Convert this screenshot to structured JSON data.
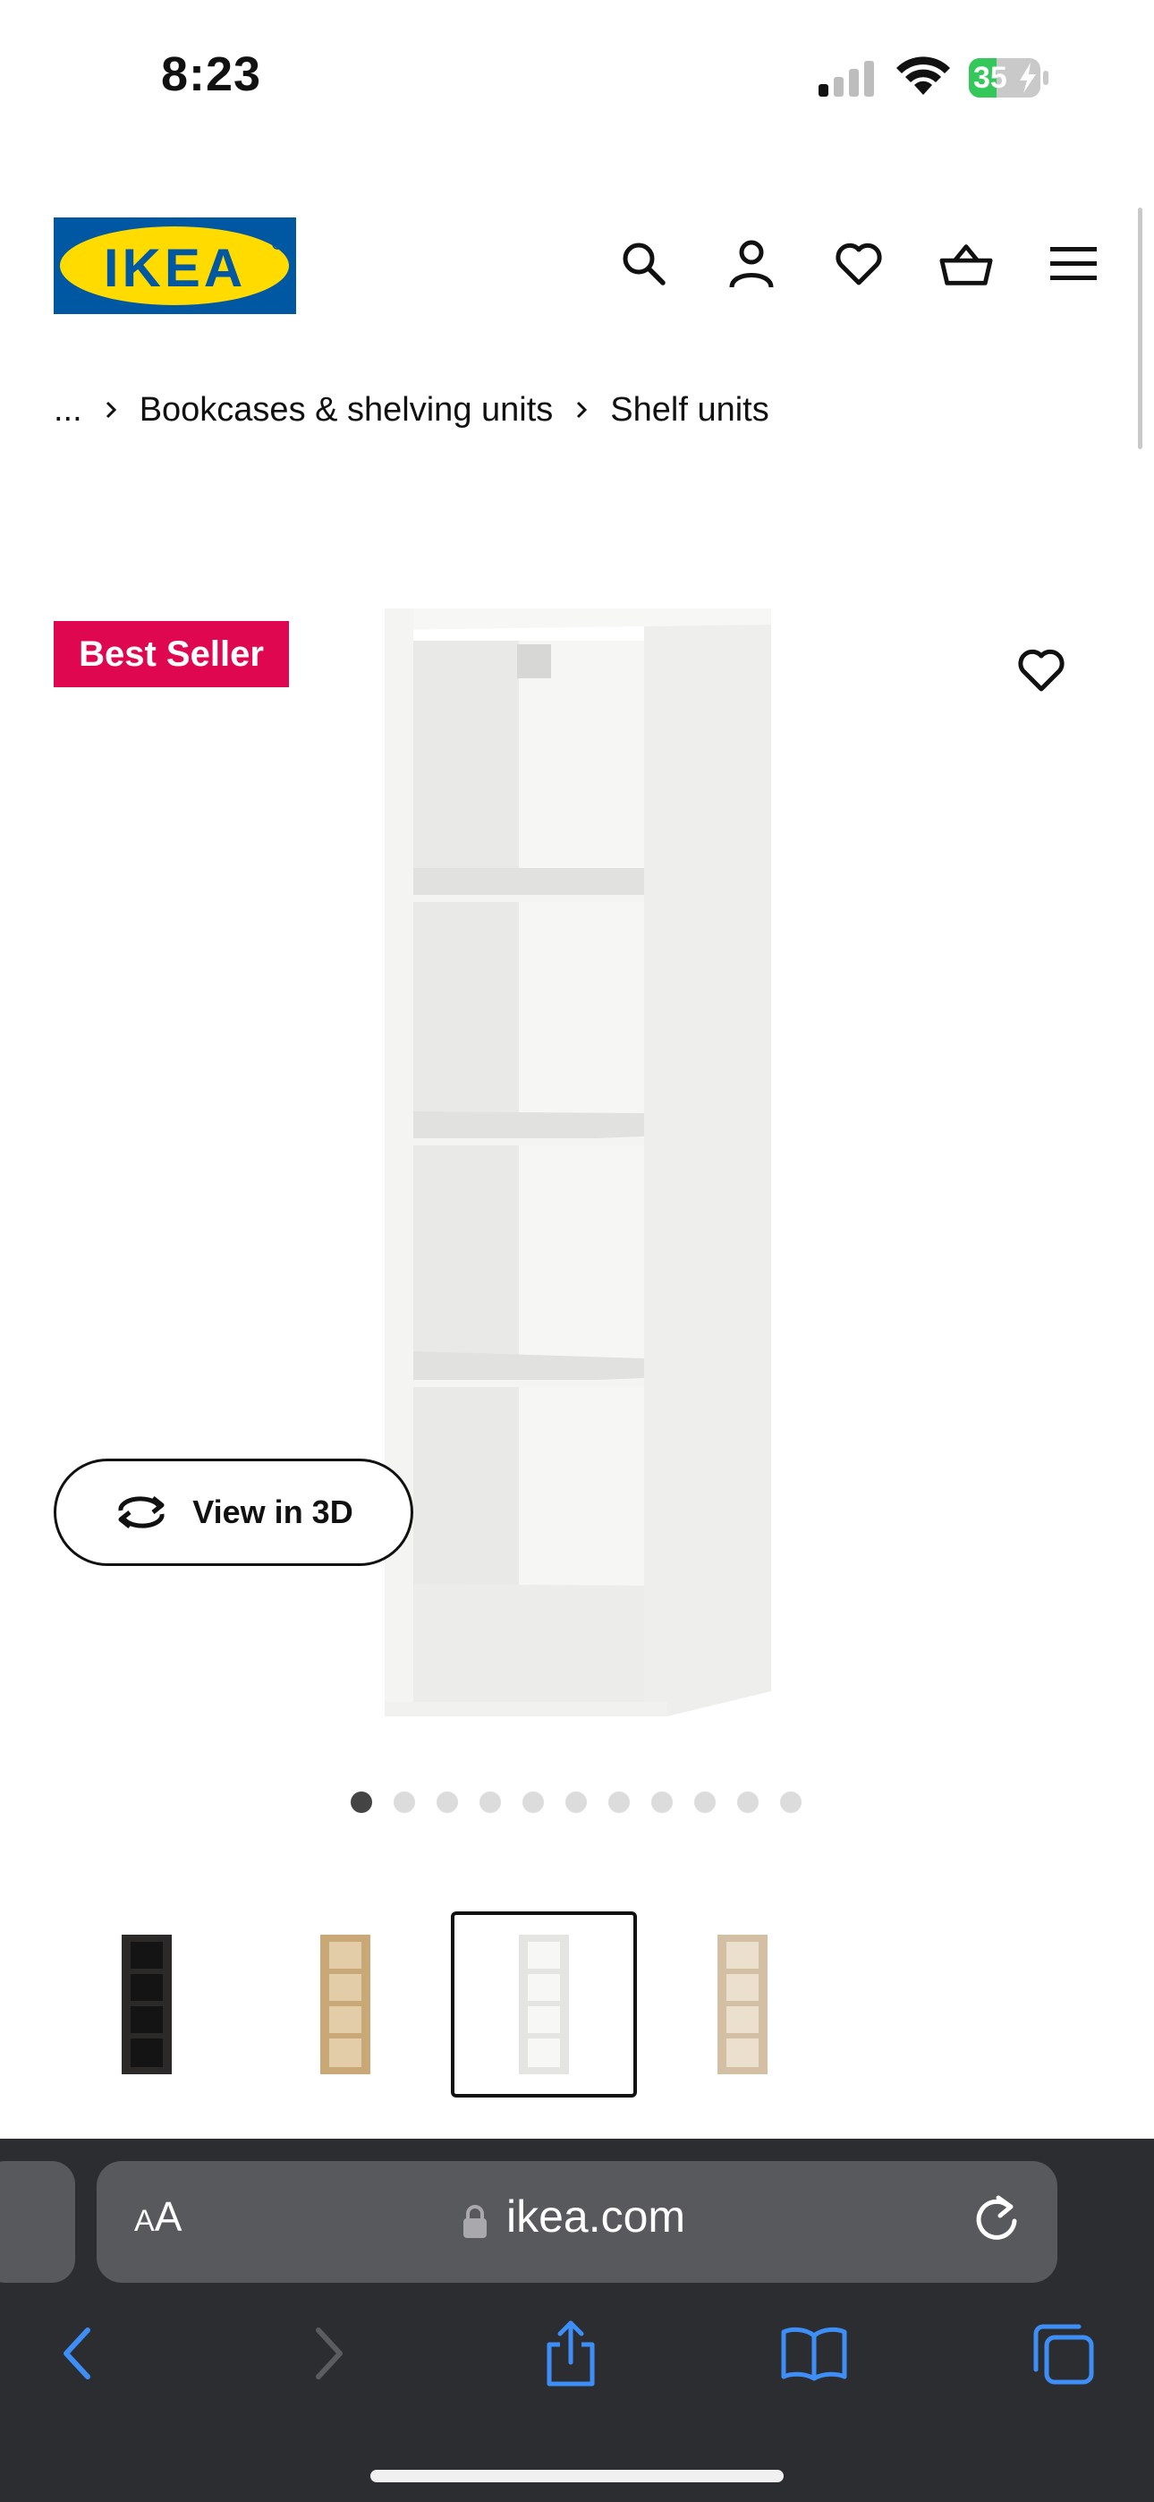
{
  "status_bar": {
    "time": "8:23",
    "battery_level": "35",
    "icons": [
      "cellular-signal-icon",
      "wifi-icon",
      "battery-charging-icon"
    ]
  },
  "header": {
    "logo_text": "IKEA",
    "icons": [
      "search-icon",
      "account-icon",
      "heart-icon",
      "basket-icon",
      "menu-icon"
    ],
    "brand_colors": {
      "blue": "#0058a3",
      "yellow": "#ffdb00"
    }
  },
  "breadcrumb": {
    "items": [
      "...",
      "Bookcases & shelving units",
      "Shelf units"
    ]
  },
  "product": {
    "badge": "Best Seller",
    "badge_color": "#e00751",
    "view_3d_label": "View in 3D",
    "carousel": {
      "total": 11,
      "active": 1
    },
    "thumbnails": [
      {
        "color": "black-brown",
        "selected": false
      },
      {
        "color": "oak effect",
        "selected": false
      },
      {
        "color": "white",
        "selected": true
      },
      {
        "color": "white stained oak effect",
        "selected": false
      }
    ]
  },
  "browser": {
    "text_size_label_small": "A",
    "text_size_label_large": "A",
    "url": "ikea.com",
    "toolbar": [
      "back-icon",
      "forward-icon",
      "share-icon",
      "bookmarks-icon",
      "tabs-icon"
    ],
    "accent_color": "#3e8ef7"
  }
}
